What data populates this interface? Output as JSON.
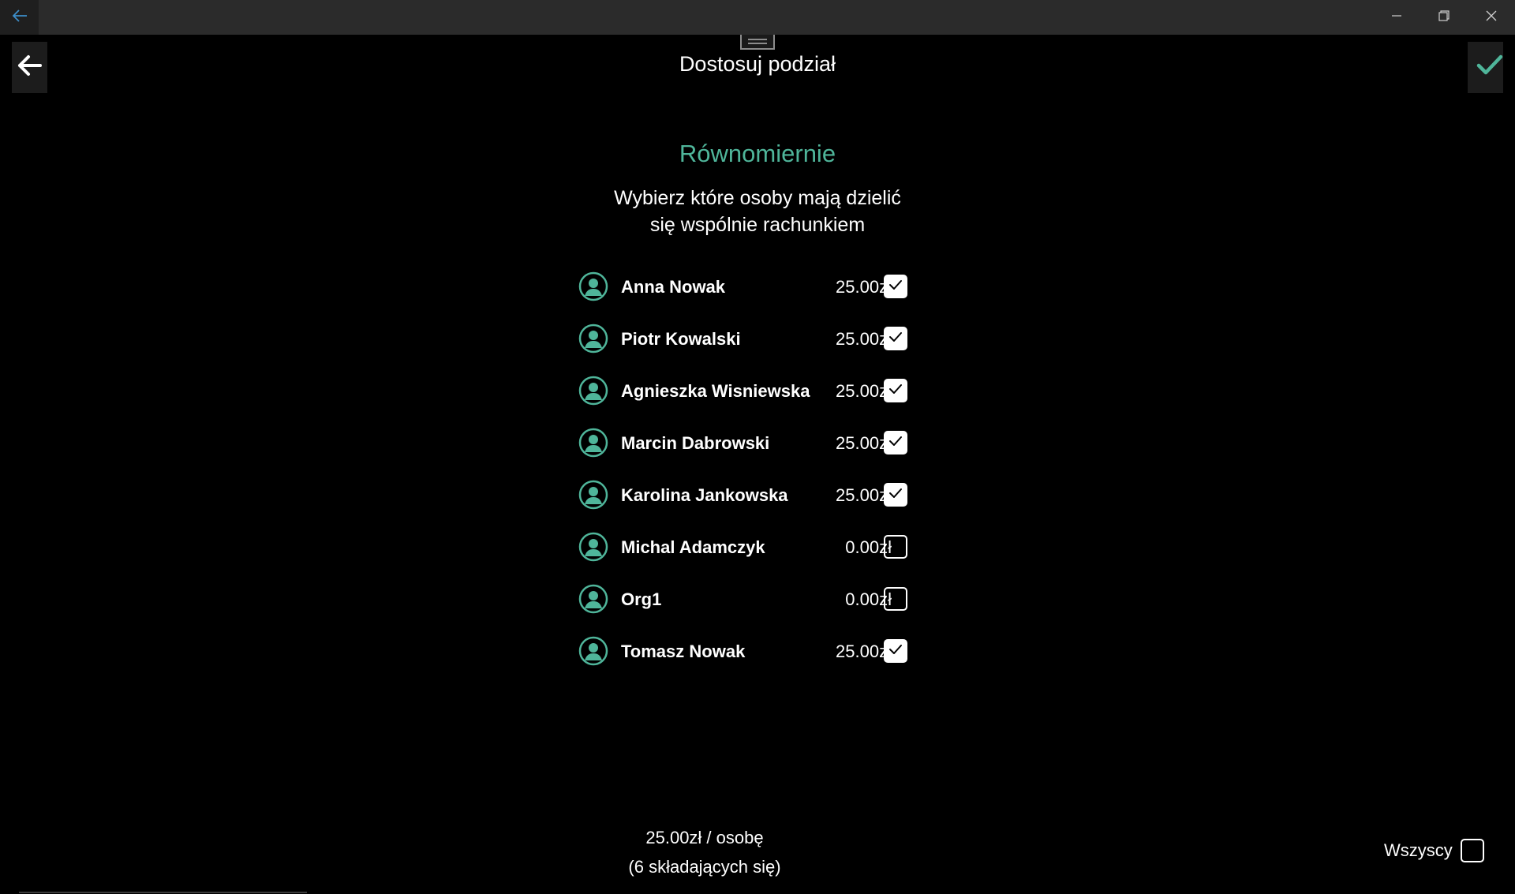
{
  "window": {
    "back_icon": "arrow-left-icon",
    "minimize_icon": "minimize-icon",
    "restore_icon": "restore-icon",
    "close_icon": "close-icon"
  },
  "header": {
    "title": "Dostosuj podział",
    "back_icon": "arrow-left-icon",
    "confirm_icon": "checkmark-icon"
  },
  "split": {
    "mode_title": "Równomiernie",
    "instruction_line1": "Wybierz które osoby mają dzielić",
    "instruction_line2": "się wspólnie rachunkiem"
  },
  "people": [
    {
      "name": "Anna Nowak",
      "amount": "25.00zł",
      "checked": true
    },
    {
      "name": "Piotr Kowalski",
      "amount": "25.00zł",
      "checked": true
    },
    {
      "name": "Agnieszka Wisniewska",
      "amount": "25.00zł",
      "checked": true
    },
    {
      "name": "Marcin Dabrowski",
      "amount": "25.00zł",
      "checked": true
    },
    {
      "name": "Karolina Jankowska",
      "amount": "25.00zł",
      "checked": true
    },
    {
      "name": "Michal Adamczyk",
      "amount": "0.00zł",
      "checked": false
    },
    {
      "name": "Org1",
      "amount": "0.00zł",
      "checked": false
    },
    {
      "name": "Tomasz Nowak",
      "amount": "25.00zł",
      "checked": true
    }
  ],
  "footer": {
    "per_person": "25.00zł / osobę",
    "participants": "(6 składających się)",
    "all_label": "Wszyscy",
    "all_checked": false
  },
  "colors": {
    "accent": "#4fb59a",
    "background": "#000000",
    "titlebar": "#2b2b2b"
  }
}
